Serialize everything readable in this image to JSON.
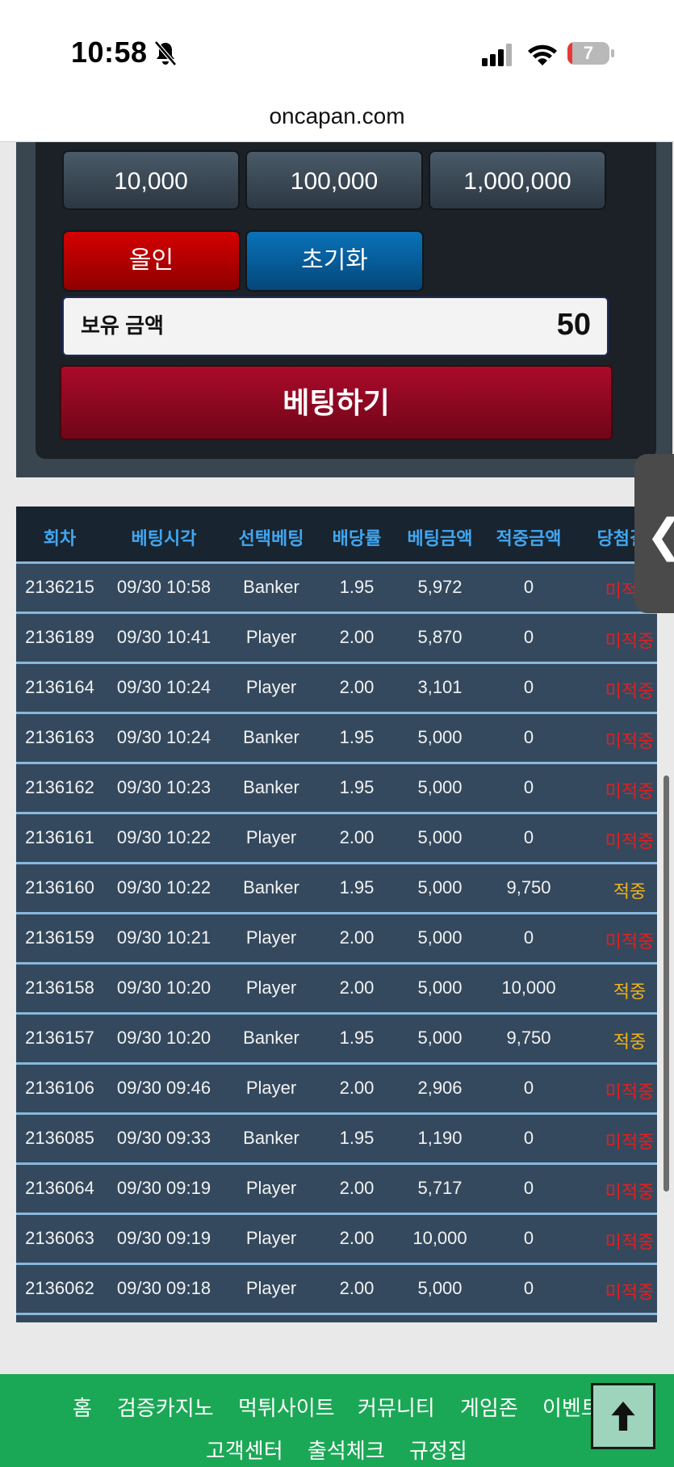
{
  "status_bar": {
    "time": "10:58",
    "battery": "7",
    "icons": [
      "bell-slash-icon",
      "signal-icon",
      "wifi-icon",
      "battery-icon"
    ]
  },
  "browser": {
    "url": "oncapan.com"
  },
  "bet_panel": {
    "chips": [
      "10,000",
      "100,000",
      "1,000,000"
    ],
    "allin_label": "올인",
    "reset_label": "초기화",
    "balance_label": "보유 금액",
    "balance_value": "50",
    "bet_label": "베팅하기"
  },
  "table": {
    "headers": [
      "회차",
      "베팅시각",
      "선택베팅",
      "배당률",
      "베팅금액",
      "적중금액",
      "당첨결과"
    ],
    "rows": [
      [
        "2136215",
        "09/30 10:58",
        "Banker",
        "1.95",
        "5,972",
        "0",
        "미적중"
      ],
      [
        "2136189",
        "09/30 10:41",
        "Player",
        "2.00",
        "5,870",
        "0",
        "미적중"
      ],
      [
        "2136164",
        "09/30 10:24",
        "Player",
        "2.00",
        "3,101",
        "0",
        "미적중"
      ],
      [
        "2136163",
        "09/30 10:24",
        "Banker",
        "1.95",
        "5,000",
        "0",
        "미적중"
      ],
      [
        "2136162",
        "09/30 10:23",
        "Banker",
        "1.95",
        "5,000",
        "0",
        "미적중"
      ],
      [
        "2136161",
        "09/30 10:22",
        "Player",
        "2.00",
        "5,000",
        "0",
        "미적중"
      ],
      [
        "2136160",
        "09/30 10:22",
        "Banker",
        "1.95",
        "5,000",
        "9,750",
        "적중"
      ],
      [
        "2136159",
        "09/30 10:21",
        "Player",
        "2.00",
        "5,000",
        "0",
        "미적중"
      ],
      [
        "2136158",
        "09/30 10:20",
        "Player",
        "2.00",
        "5,000",
        "10,000",
        "적중"
      ],
      [
        "2136157",
        "09/30 10:20",
        "Banker",
        "1.95",
        "5,000",
        "9,750",
        "적중"
      ],
      [
        "2136106",
        "09/30 09:46",
        "Player",
        "2.00",
        "2,906",
        "0",
        "미적중"
      ],
      [
        "2136085",
        "09/30 09:33",
        "Banker",
        "1.95",
        "1,190",
        "0",
        "미적중"
      ],
      [
        "2136064",
        "09/30 09:19",
        "Player",
        "2.00",
        "5,717",
        "0",
        "미적중"
      ],
      [
        "2136063",
        "09/30 09:19",
        "Player",
        "2.00",
        "10,000",
        "0",
        "미적중"
      ],
      [
        "2136062",
        "09/30 09:18",
        "Player",
        "2.00",
        "5,000",
        "0",
        "미적중"
      ]
    ]
  },
  "side_handle": {
    "icon": "chevron-left-icon",
    "glyph": "❮"
  },
  "footer": {
    "nav_row1": [
      "홈",
      "검증카지노",
      "먹튀사이트",
      "커뮤니티",
      "게임존",
      "이벤트"
    ],
    "nav_row2": [
      "고객센터",
      "출석체크",
      "규정집"
    ],
    "to_top_icon": "arrow-up-icon",
    "to_top_glyph": "🡅"
  },
  "colors": {
    "win": "#f0b21a",
    "lose": "#e02020",
    "header_text": "#41a6f0",
    "footer_bg": "#1ba856"
  }
}
